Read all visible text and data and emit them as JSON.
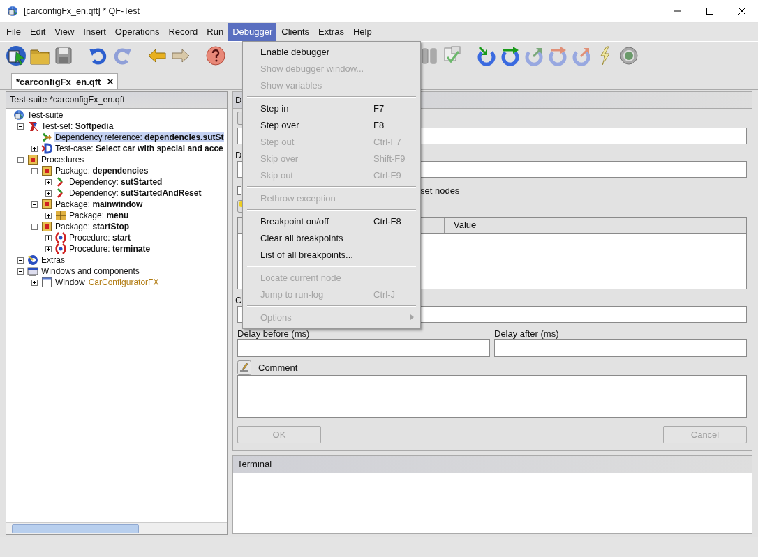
{
  "window": {
    "title": "[carconfigFx_en.qft] * QF-Test"
  },
  "menubar": [
    {
      "label": "File",
      "selected": false
    },
    {
      "label": "Edit",
      "selected": false
    },
    {
      "label": "View",
      "selected": false
    },
    {
      "label": "Insert",
      "selected": false
    },
    {
      "label": "Operations",
      "selected": false
    },
    {
      "label": "Record",
      "selected": false
    },
    {
      "label": "Run",
      "selected": false
    },
    {
      "label": "Debugger",
      "selected": true
    },
    {
      "label": "Clients",
      "selected": false
    },
    {
      "label": "Extras",
      "selected": false
    },
    {
      "label": "Help",
      "selected": false
    }
  ],
  "tabs": [
    {
      "label": "*carconfigFx_en.qft",
      "selected": true
    }
  ],
  "tree_panel": {
    "title": "Test-suite *carconfigFx_en.qft",
    "nodes": [
      {
        "kind": "suite",
        "text": "Test-suite",
        "selected": false,
        "children": [
          {
            "kind": "testset",
            "text": "Test-set: **Softpedia**",
            "expanded": true,
            "selected": false,
            "children": [
              {
                "kind": "dependency-reference",
                "text": "Dependency reference: **dependencies.sutSt**",
                "selected": true
              },
              {
                "kind": "testcase",
                "text": "Test-case: **Select car with special and acce**",
                "expanded": false,
                "selected": false
              }
            ]
          },
          {
            "kind": "package",
            "text": "Procedures",
            "expanded": true,
            "selected": false,
            "children": [
              {
                "kind": "package",
                "text": "Package: **dependencies**",
                "expanded": true,
                "selected": false,
                "children": [
                  {
                    "kind": "dependency",
                    "text": "Dependency: **sutStarted**",
                    "expanded": false,
                    "selected": false
                  },
                  {
                    "kind": "dependency",
                    "text": "Dependency: **sutStartedAndReset**",
                    "expanded": false,
                    "selected": false
                  }
                ]
              },
              {
                "kind": "package",
                "text": "Package: **mainwindow**",
                "expanded": true,
                "selected": false,
                "children": [
                  {
                    "kind": "grid-package",
                    "text": "Package: **menu**",
                    "expanded": false,
                    "selected": false
                  }
                ]
              },
              {
                "kind": "package",
                "text": "Package: **startStop**",
                "expanded": true,
                "selected": false,
                "children": [
                  {
                    "kind": "procedure",
                    "text": "Procedure: **start**",
                    "expanded": false,
                    "selected": false
                  },
                  {
                    "kind": "procedure",
                    "text": "Procedure: **terminate**",
                    "expanded": false,
                    "selected": false
                  }
                ]
              }
            ]
          },
          {
            "kind": "extras",
            "text": "Extras",
            "expanded": true,
            "selected": false
          },
          {
            "kind": "windows",
            "text": "Windows and components",
            "expanded": true,
            "selected": false,
            "children": [
              {
                "kind": "window",
                "text": "Window",
                "target": "CarConfiguratorFX",
                "expanded": false,
                "selected": false
              }
            ]
          }
        ]
      }
    ]
  },
  "detail_panel": {
    "title": "D",
    "field_2_label": "D",
    "checkbox": {
      "label": "set nodes",
      "checked": false
    },
    "table": {
      "columns": [
        "Value"
      ]
    },
    "field_3_label": "C",
    "delay_before": {
      "label": "Delay before (ms)"
    },
    "delay_after": {
      "label": "Delay after (ms)"
    },
    "comment": {
      "label": "Comment"
    },
    "buttons": [
      {
        "label": "OK",
        "disabled": true
      },
      {
        "label": "Cancel",
        "disabled": true
      }
    ]
  },
  "terminal": {
    "title": "Terminal"
  },
  "debugger_menu": [
    {
      "kind": "item",
      "label": "Enable debugger",
      "disabled": false
    },
    {
      "kind": "item",
      "label": "Show debugger window...",
      "disabled": true
    },
    {
      "kind": "item",
      "label": "Show variables",
      "disabled": true
    },
    {
      "kind": "separator"
    },
    {
      "kind": "item",
      "label": "Step in",
      "shortcut": "F7",
      "disabled": false
    },
    {
      "kind": "item",
      "label": "Step over",
      "shortcut": "F8",
      "disabled": false
    },
    {
      "kind": "item",
      "label": "Step out",
      "shortcut": "Ctrl-F7",
      "disabled": true
    },
    {
      "kind": "item",
      "label": "Skip over",
      "shortcut": "Shift-F9",
      "disabled": true
    },
    {
      "kind": "item",
      "label": "Skip out",
      "shortcut": "Ctrl-F9",
      "disabled": true
    },
    {
      "kind": "separator"
    },
    {
      "kind": "item",
      "label": "Rethrow exception",
      "disabled": true
    },
    {
      "kind": "separator"
    },
    {
      "kind": "item",
      "label": "Breakpoint on/off",
      "shortcut": "Ctrl-F8",
      "disabled": false
    },
    {
      "kind": "item",
      "label": "Clear all breakpoints",
      "disabled": false
    },
    {
      "kind": "item",
      "label": "List of all breakpoints...",
      "disabled": false
    },
    {
      "kind": "separator"
    },
    {
      "kind": "item",
      "label": "Locate current node",
      "disabled": true
    },
    {
      "kind": "item",
      "label": "Jump to run-log",
      "shortcut": "Ctrl-J",
      "disabled": true
    },
    {
      "kind": "separator"
    },
    {
      "kind": "submenu",
      "label": "Options",
      "disabled": true
    }
  ]
}
